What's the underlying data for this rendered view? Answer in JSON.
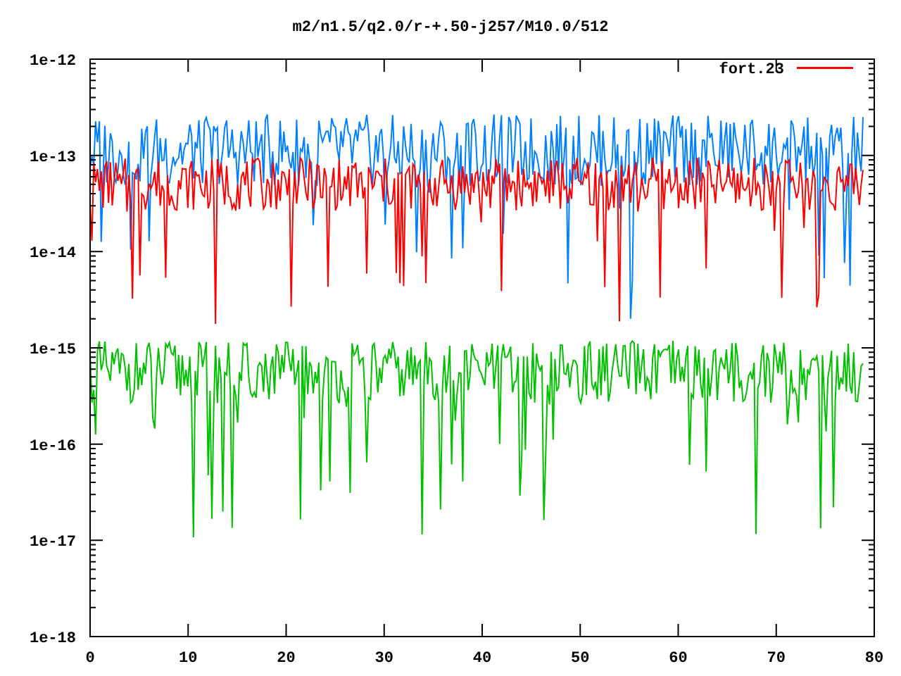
{
  "plot": {
    "title": "m2/n1.5/q2.0/r-+.50-j257/M10.0/512",
    "x_ticks": [
      "0",
      "10",
      "20",
      "30",
      "40",
      "50",
      "60",
      "70",
      "80"
    ],
    "y_ticks": [
      "1e-12",
      "1e-13",
      "1e-14",
      "1e-15",
      "1e-16",
      "1e-17",
      "1e-18"
    ],
    "legend": [
      {
        "label": "fort.23",
        "color": "#ff0000"
      }
    ]
  }
}
